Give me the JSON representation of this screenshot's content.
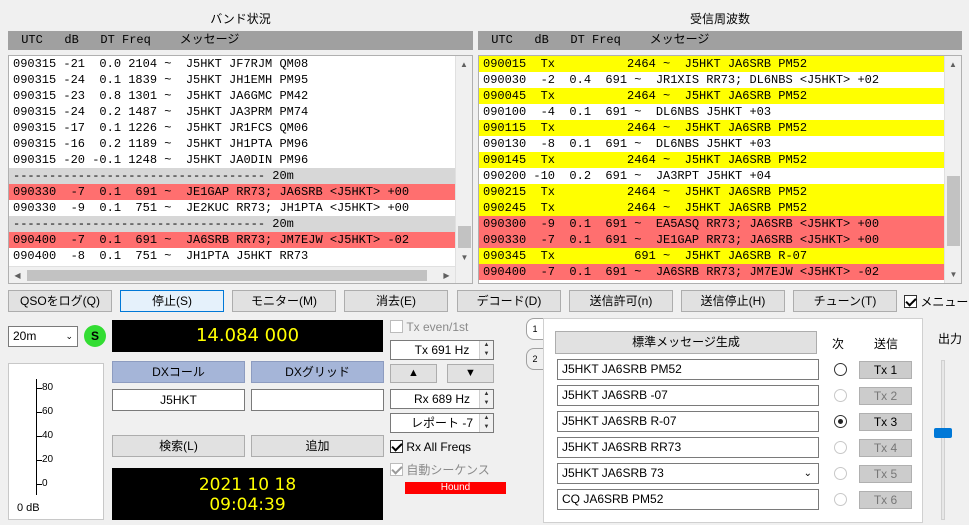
{
  "band_activity": {
    "title": "バンド状況",
    "header": " UTC   dB   DT Freq    メッセージ",
    "rows": [
      {
        "text": "090315 -21  0.0 2104 ~  J5HKT JF7RJM QM08",
        "style": "normal"
      },
      {
        "text": "090315 -24  0.1 1839 ~  J5HKT JH1EMH PM95",
        "style": "normal"
      },
      {
        "text": "090315 -23  0.8 1301 ~  J5HKT JA6GMC PM42",
        "style": "normal"
      },
      {
        "text": "090315 -24  0.2 1487 ~  J5HKT JA3PRM PM74",
        "style": "normal"
      },
      {
        "text": "090315 -17  0.1 1226 ~  J5HKT JR1FCS QM06",
        "style": "normal"
      },
      {
        "text": "090315 -16  0.2 1189 ~  J5HKT JH1PTA PM96",
        "style": "normal"
      },
      {
        "text": "090315 -20 -0.1 1248 ~  J5HKT JA0DIN PM96",
        "style": "normal"
      },
      {
        "text": "----------------------------------- 20m",
        "style": "sep"
      },
      {
        "text": "090330  -7  0.1  691 ~  JE1GAP RR73; JA6SRB <J5HKT> +00",
        "style": "red"
      },
      {
        "text": "090330  -9  0.1  751 ~  JE2KUC RR73; JH1PTA <J5HKT> +00",
        "style": "normal"
      },
      {
        "text": "----------------------------------- 20m",
        "style": "sep"
      },
      {
        "text": "090400  -7  0.1  691 ~  JA6SRB RR73; JM7EJW <J5HKT> -02",
        "style": "red"
      },
      {
        "text": "090400  -8  0.1  751 ~  JH1PTA J5HKT RR73",
        "style": "normal"
      }
    ]
  },
  "rx_frequency": {
    "title": "受信周波数",
    "header": " UTC   dB   DT Freq    メッセージ",
    "rows": [
      {
        "text": "090015  Tx          2464 ~  J5HKT JA6SRB PM52",
        "style": "yel"
      },
      {
        "text": "090030  -2  0.4  691 ~  JR1XIS RR73; DL6NBS <J5HKT> +02",
        "style": "normal"
      },
      {
        "text": "090045  Tx          2464 ~  J5HKT JA6SRB PM52",
        "style": "yel"
      },
      {
        "text": "090100  -4  0.1  691 ~  DL6NBS J5HKT +03",
        "style": "normal"
      },
      {
        "text": "090115  Tx          2464 ~  J5HKT JA6SRB PM52",
        "style": "yel"
      },
      {
        "text": "090130  -8  0.1  691 ~  DL6NBS J5HKT +03",
        "style": "normal"
      },
      {
        "text": "090145  Tx          2464 ~  J5HKT JA6SRB PM52",
        "style": "yel"
      },
      {
        "text": "090200 -10  0.2  691 ~  JA3RPT J5HKT +04",
        "style": "normal"
      },
      {
        "text": "090215  Tx          2464 ~  J5HKT JA6SRB PM52",
        "style": "yel"
      },
      {
        "text": "090245  Tx          2464 ~  J5HKT JA6SRB PM52",
        "style": "yel"
      },
      {
        "text": "090300  -9  0.1  691 ~  EA5ASQ RR73; JA6SRB <J5HKT> +00",
        "style": "red"
      },
      {
        "text": "090330  -7  0.1  691 ~  JE1GAP RR73; JA6SRB <J5HKT> +00",
        "style": "red"
      },
      {
        "text": "090345  Tx           691 ~  J5HKT JA6SRB R-07",
        "style": "yel"
      },
      {
        "text": "090400  -7  0.1  691 ~  JA6SRB RR73; JM7EJW <J5HKT> -02",
        "style": "red"
      }
    ]
  },
  "buttons": {
    "log_qso": "QSOをログ(Q)",
    "stop": "停止(S)",
    "monitor": "モニター(M)",
    "erase": "消去(E)",
    "decode": "デコード(D)",
    "enable_tx": "送信許可(n)",
    "halt_tx": "送信停止(H)",
    "tune": "チューン(T)",
    "menus": "メニュー"
  },
  "left": {
    "band": "20m",
    "s_label": "S",
    "meter_ticks": [
      "80",
      "60",
      "40",
      "20",
      "0"
    ],
    "meter_value": "0 dB"
  },
  "center": {
    "frequency": "14.084 000",
    "dx_call_label": "DXコール",
    "dx_grid_label": "DXグリッド",
    "dx_call": "J5HKT",
    "dx_grid": "",
    "lookup": "検索(L)",
    "add": "追加",
    "date": "2021 10 18",
    "time": "09:04:39"
  },
  "controls": {
    "tx_even": "Tx even/1st",
    "tx_freq": "Tx  691  Hz",
    "rx_freq": "Rx  689  Hz",
    "report": "レポート -7",
    "rx_all": "Rx All Freqs",
    "auto_seq": "自動シーケンス",
    "hound": "Hound",
    "up_arrow": "▲",
    "down_arrow": "▼"
  },
  "messages": {
    "tab1": "1",
    "tab2": "2",
    "generate": "標準メッセージ生成",
    "next_label": "次",
    "send_label": "送信",
    "items": [
      {
        "text": "J5HKT JA6SRB PM52",
        "tx": "Tx 1"
      },
      {
        "text": "J5HKT JA6SRB -07",
        "tx": "Tx 2"
      },
      {
        "text": "J5HKT JA6SRB R-07",
        "tx": "Tx 3"
      },
      {
        "text": "J5HKT JA6SRB RR73",
        "tx": "Tx 4"
      },
      {
        "text": "J5HKT JA6SRB 73",
        "tx": "Tx 5"
      },
      {
        "text": "CQ  JA6SRB PM52",
        "tx": "Tx 6"
      }
    ]
  },
  "output": {
    "label": "出力"
  },
  "colors": {
    "red_row": "#ff6f6f",
    "yellow_row": "#ffff00",
    "freq_text": "#ffff00",
    "hound": "#ff0000",
    "indicator_green": "#33dd33"
  }
}
